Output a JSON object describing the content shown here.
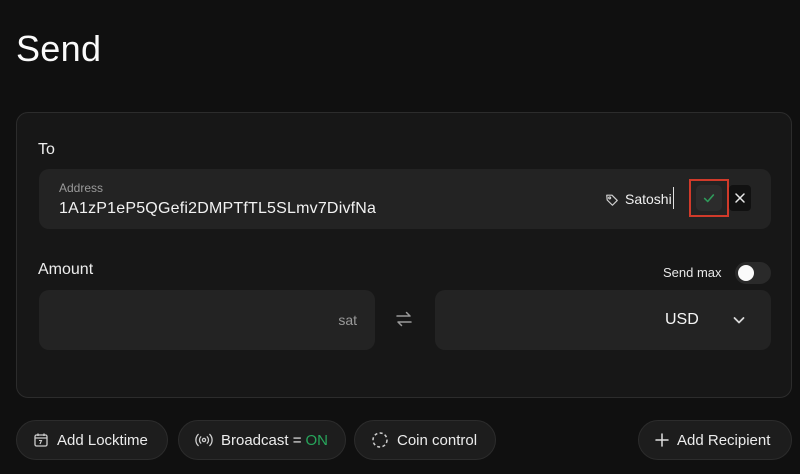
{
  "page": {
    "title": "Send"
  },
  "to": {
    "label": "To",
    "address_caption": "Address",
    "address_value": "1A1zP1eP5QGefi2DMPTfTL5SLmv7DivfNa",
    "label_value": "Satoshi",
    "tag_icon": "tag-icon",
    "confirm_icon": "check-icon",
    "cancel_icon": "close-icon"
  },
  "amount": {
    "label": "Amount",
    "send_max_label": "Send max",
    "send_max_enabled": false,
    "sat_value": "",
    "sat_unit": "sat",
    "swap_icon": "swap-arrows-icon",
    "currency_value": "USD"
  },
  "actions": {
    "add_locktime": "Add Locktime",
    "broadcast_label": "Broadcast =",
    "broadcast_state": "ON",
    "coin_control": "Coin control",
    "add_recipient": "Add Recipient"
  },
  "colors": {
    "background": "#101010",
    "card": "#171717",
    "field": "#232323",
    "on_green": "#27a55b",
    "highlight_red": "#d03a2a"
  }
}
